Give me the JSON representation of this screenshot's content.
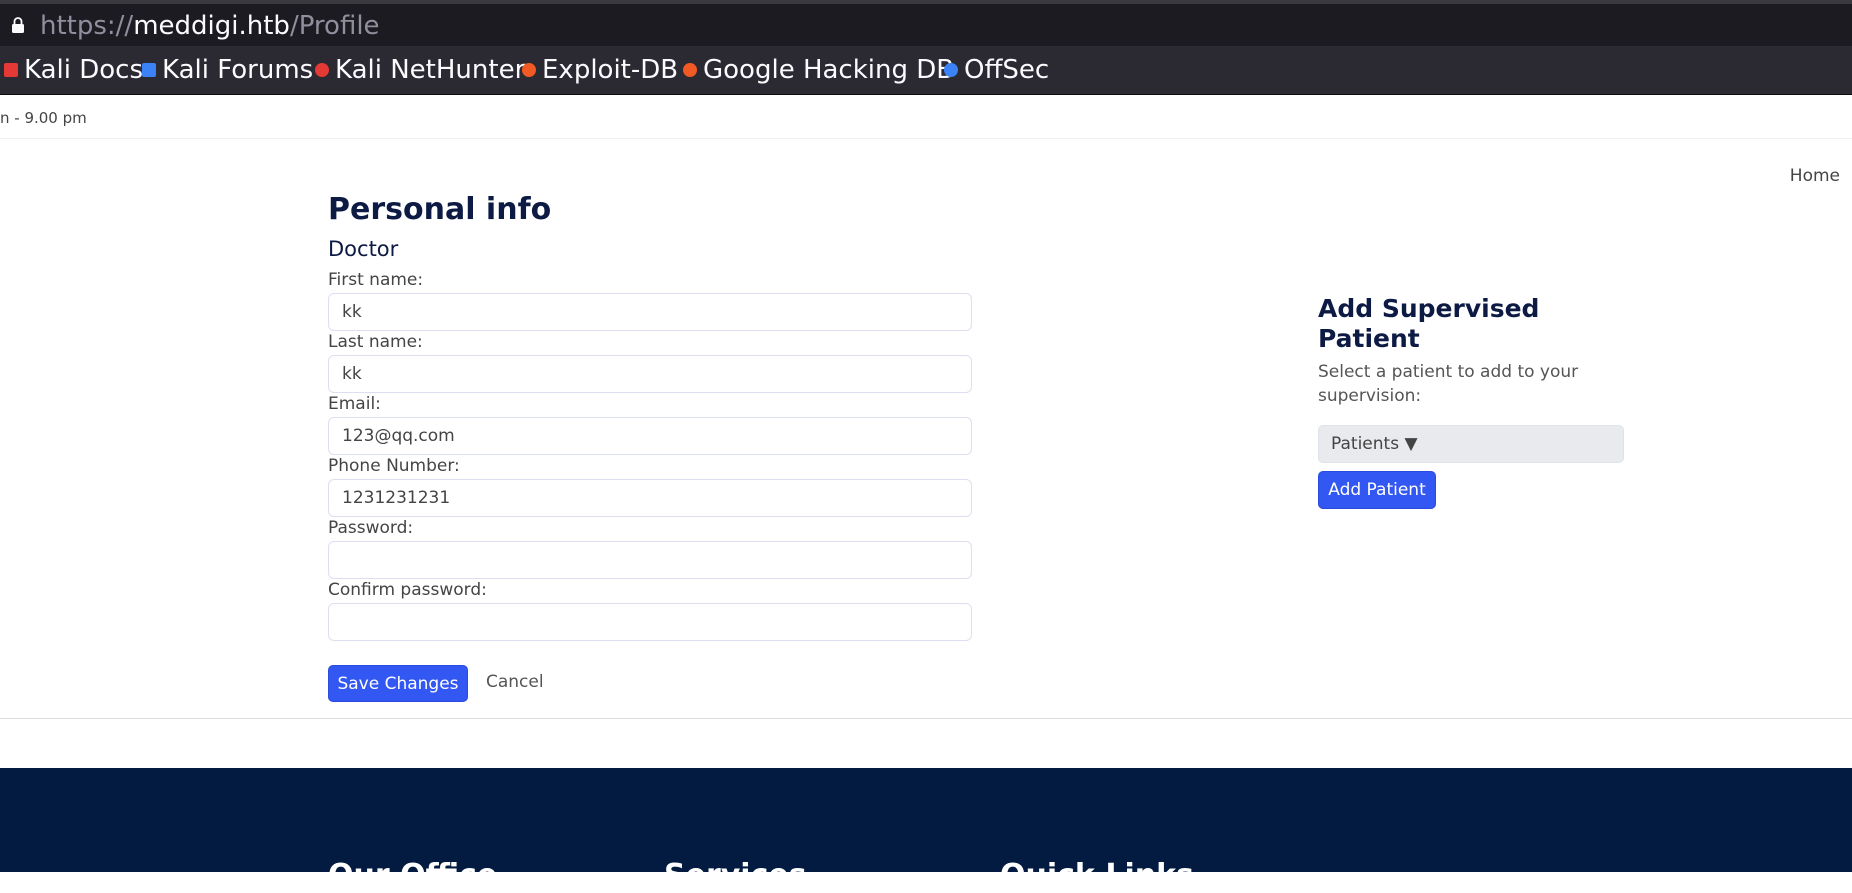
{
  "browser": {
    "url_scheme": "https://",
    "url_host": "meddigi.htb",
    "url_path": "/Profile",
    "bookmarks": [
      {
        "label": "Kali Docs",
        "color": "#e53935"
      },
      {
        "label": "Kali Forums",
        "color": "#3b82f6"
      },
      {
        "label": "Kali NetHunter",
        "color": "#e53935"
      },
      {
        "label": "Exploit-DB",
        "color": "#f15a24"
      },
      {
        "label": "Google Hacking DB",
        "color": "#f15a24"
      },
      {
        "label": "OffSec",
        "color": "#3b82f6"
      }
    ]
  },
  "topbar": {
    "hours": "n - 9.00 pm"
  },
  "nav": {
    "home": "Home"
  },
  "profile": {
    "title": "Personal info",
    "role": "Doctor",
    "fields": [
      {
        "label": "First name:",
        "value": "kk"
      },
      {
        "label": "Last name:",
        "value": "kk"
      },
      {
        "label": "Email:",
        "value": "123@qq.com"
      },
      {
        "label": "Phone Number:",
        "value": "1231231231"
      },
      {
        "label": "Password:",
        "value": ""
      },
      {
        "label": "Confirm password:",
        "value": ""
      }
    ],
    "save_label": "Save Changes",
    "cancel_label": "Cancel"
  },
  "supervise": {
    "title": "Add Supervised Patient",
    "description": "Select a patient to add to your supervision:",
    "select_label": "Patients ▼",
    "button_label": "Add Patient"
  },
  "footer": {
    "columns": [
      "Our Office",
      "Services",
      "Quick Links"
    ]
  },
  "colors": {
    "primary": "#3257f2",
    "heading": "#0c1a44",
    "footer_bg": "#031b40"
  }
}
